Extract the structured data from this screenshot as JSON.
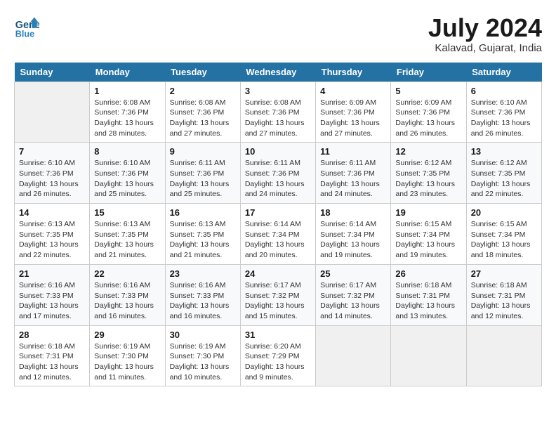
{
  "logo": {
    "text_general": "General",
    "text_blue": "Blue"
  },
  "header": {
    "month": "July 2024",
    "location": "Kalavad, Gujarat, India"
  },
  "days_of_week": [
    "Sunday",
    "Monday",
    "Tuesday",
    "Wednesday",
    "Thursday",
    "Friday",
    "Saturday"
  ],
  "weeks": [
    [
      {
        "day": "",
        "sunrise": "",
        "sunset": "",
        "daylight": ""
      },
      {
        "day": "1",
        "sunrise": "Sunrise: 6:08 AM",
        "sunset": "Sunset: 7:36 PM",
        "daylight": "Daylight: 13 hours and 28 minutes."
      },
      {
        "day": "2",
        "sunrise": "Sunrise: 6:08 AM",
        "sunset": "Sunset: 7:36 PM",
        "daylight": "Daylight: 13 hours and 27 minutes."
      },
      {
        "day": "3",
        "sunrise": "Sunrise: 6:08 AM",
        "sunset": "Sunset: 7:36 PM",
        "daylight": "Daylight: 13 hours and 27 minutes."
      },
      {
        "day": "4",
        "sunrise": "Sunrise: 6:09 AM",
        "sunset": "Sunset: 7:36 PM",
        "daylight": "Daylight: 13 hours and 27 minutes."
      },
      {
        "day": "5",
        "sunrise": "Sunrise: 6:09 AM",
        "sunset": "Sunset: 7:36 PM",
        "daylight": "Daylight: 13 hours and 26 minutes."
      },
      {
        "day": "6",
        "sunrise": "Sunrise: 6:10 AM",
        "sunset": "Sunset: 7:36 PM",
        "daylight": "Daylight: 13 hours and 26 minutes."
      }
    ],
    [
      {
        "day": "7",
        "sunrise": "Sunrise: 6:10 AM",
        "sunset": "Sunset: 7:36 PM",
        "daylight": "Daylight: 13 hours and 26 minutes."
      },
      {
        "day": "8",
        "sunrise": "Sunrise: 6:10 AM",
        "sunset": "Sunset: 7:36 PM",
        "daylight": "Daylight: 13 hours and 25 minutes."
      },
      {
        "day": "9",
        "sunrise": "Sunrise: 6:11 AM",
        "sunset": "Sunset: 7:36 PM",
        "daylight": "Daylight: 13 hours and 25 minutes."
      },
      {
        "day": "10",
        "sunrise": "Sunrise: 6:11 AM",
        "sunset": "Sunset: 7:36 PM",
        "daylight": "Daylight: 13 hours and 24 minutes."
      },
      {
        "day": "11",
        "sunrise": "Sunrise: 6:11 AM",
        "sunset": "Sunset: 7:36 PM",
        "daylight": "Daylight: 13 hours and 24 minutes."
      },
      {
        "day": "12",
        "sunrise": "Sunrise: 6:12 AM",
        "sunset": "Sunset: 7:35 PM",
        "daylight": "Daylight: 13 hours and 23 minutes."
      },
      {
        "day": "13",
        "sunrise": "Sunrise: 6:12 AM",
        "sunset": "Sunset: 7:35 PM",
        "daylight": "Daylight: 13 hours and 22 minutes."
      }
    ],
    [
      {
        "day": "14",
        "sunrise": "Sunrise: 6:13 AM",
        "sunset": "Sunset: 7:35 PM",
        "daylight": "Daylight: 13 hours and 22 minutes."
      },
      {
        "day": "15",
        "sunrise": "Sunrise: 6:13 AM",
        "sunset": "Sunset: 7:35 PM",
        "daylight": "Daylight: 13 hours and 21 minutes."
      },
      {
        "day": "16",
        "sunrise": "Sunrise: 6:13 AM",
        "sunset": "Sunset: 7:35 PM",
        "daylight": "Daylight: 13 hours and 21 minutes."
      },
      {
        "day": "17",
        "sunrise": "Sunrise: 6:14 AM",
        "sunset": "Sunset: 7:34 PM",
        "daylight": "Daylight: 13 hours and 20 minutes."
      },
      {
        "day": "18",
        "sunrise": "Sunrise: 6:14 AM",
        "sunset": "Sunset: 7:34 PM",
        "daylight": "Daylight: 13 hours and 19 minutes."
      },
      {
        "day": "19",
        "sunrise": "Sunrise: 6:15 AM",
        "sunset": "Sunset: 7:34 PM",
        "daylight": "Daylight: 13 hours and 19 minutes."
      },
      {
        "day": "20",
        "sunrise": "Sunrise: 6:15 AM",
        "sunset": "Sunset: 7:34 PM",
        "daylight": "Daylight: 13 hours and 18 minutes."
      }
    ],
    [
      {
        "day": "21",
        "sunrise": "Sunrise: 6:16 AM",
        "sunset": "Sunset: 7:33 PM",
        "daylight": "Daylight: 13 hours and 17 minutes."
      },
      {
        "day": "22",
        "sunrise": "Sunrise: 6:16 AM",
        "sunset": "Sunset: 7:33 PM",
        "daylight": "Daylight: 13 hours and 16 minutes."
      },
      {
        "day": "23",
        "sunrise": "Sunrise: 6:16 AM",
        "sunset": "Sunset: 7:33 PM",
        "daylight": "Daylight: 13 hours and 16 minutes."
      },
      {
        "day": "24",
        "sunrise": "Sunrise: 6:17 AM",
        "sunset": "Sunset: 7:32 PM",
        "daylight": "Daylight: 13 hours and 15 minutes."
      },
      {
        "day": "25",
        "sunrise": "Sunrise: 6:17 AM",
        "sunset": "Sunset: 7:32 PM",
        "daylight": "Daylight: 13 hours and 14 minutes."
      },
      {
        "day": "26",
        "sunrise": "Sunrise: 6:18 AM",
        "sunset": "Sunset: 7:31 PM",
        "daylight": "Daylight: 13 hours and 13 minutes."
      },
      {
        "day": "27",
        "sunrise": "Sunrise: 6:18 AM",
        "sunset": "Sunset: 7:31 PM",
        "daylight": "Daylight: 13 hours and 12 minutes."
      }
    ],
    [
      {
        "day": "28",
        "sunrise": "Sunrise: 6:18 AM",
        "sunset": "Sunset: 7:31 PM",
        "daylight": "Daylight: 13 hours and 12 minutes."
      },
      {
        "day": "29",
        "sunrise": "Sunrise: 6:19 AM",
        "sunset": "Sunset: 7:30 PM",
        "daylight": "Daylight: 13 hours and 11 minutes."
      },
      {
        "day": "30",
        "sunrise": "Sunrise: 6:19 AM",
        "sunset": "Sunset: 7:30 PM",
        "daylight": "Daylight: 13 hours and 10 minutes."
      },
      {
        "day": "31",
        "sunrise": "Sunrise: 6:20 AM",
        "sunset": "Sunset: 7:29 PM",
        "daylight": "Daylight: 13 hours and 9 minutes."
      },
      {
        "day": "",
        "sunrise": "",
        "sunset": "",
        "daylight": ""
      },
      {
        "day": "",
        "sunrise": "",
        "sunset": "",
        "daylight": ""
      },
      {
        "day": "",
        "sunrise": "",
        "sunset": "",
        "daylight": ""
      }
    ]
  ]
}
